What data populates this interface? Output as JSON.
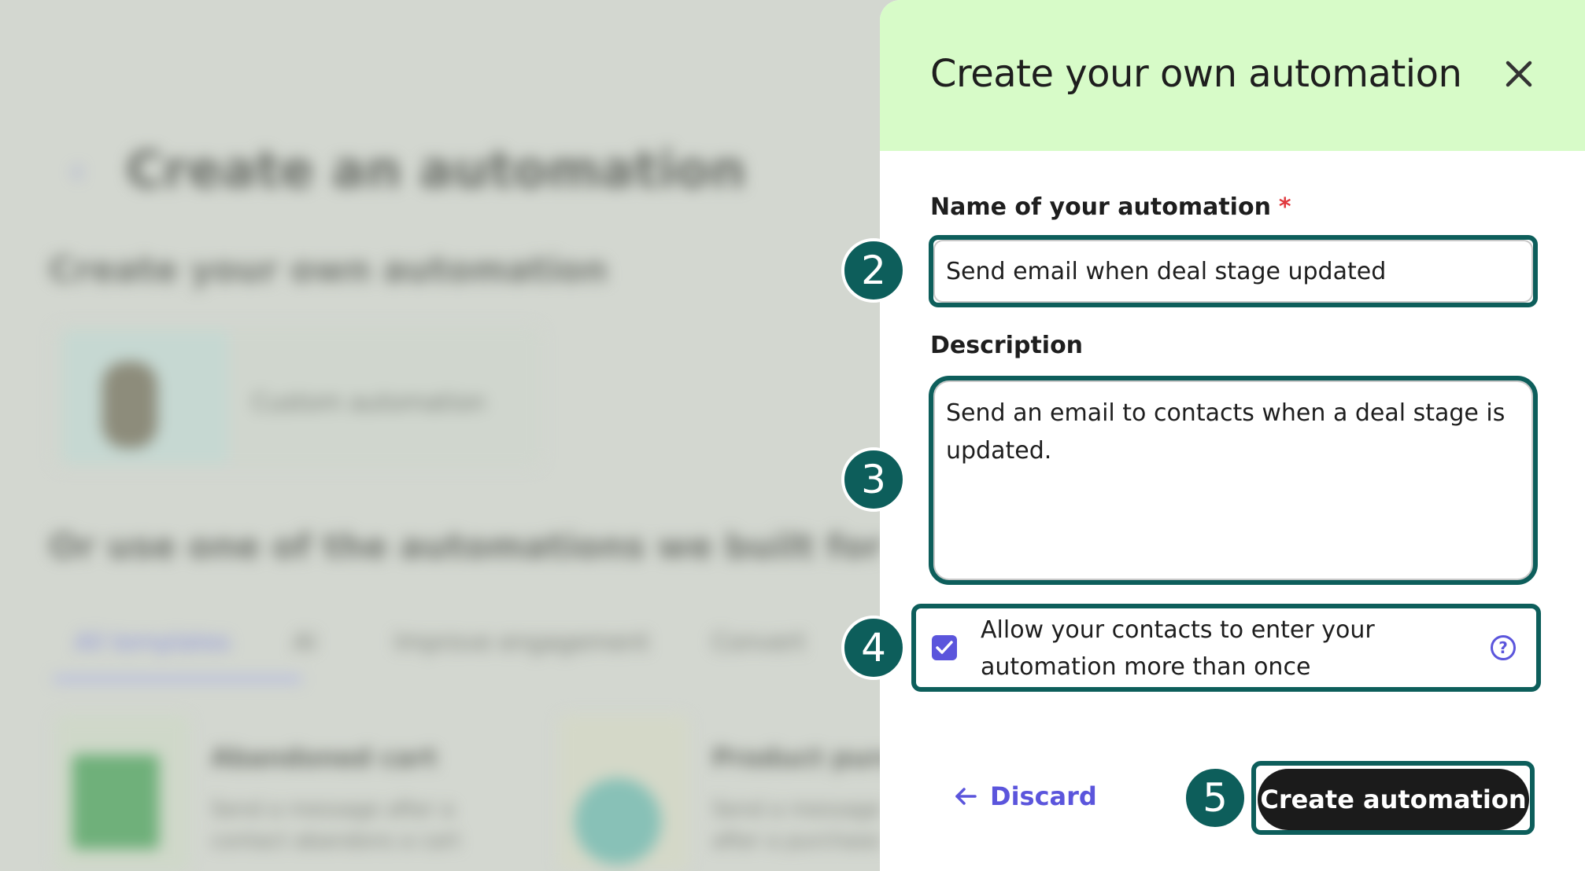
{
  "background": {
    "title": "Create an automation",
    "subtitle": "Create your own automation",
    "card_label": "Custom automation",
    "section_heading": "Or use one of the automations we built for you",
    "tabs": [
      "All templates",
      "AI",
      "Improve engagement",
      "Convert"
    ],
    "template_cards": [
      {
        "title": "Abandoned cart",
        "lines": [
          "Send a message after a",
          "contact abandons a cart"
        ]
      },
      {
        "title": "Product purchase",
        "lines": [
          "Send a message",
          "after a purchase"
        ]
      }
    ]
  },
  "panel": {
    "title": "Create your own automation",
    "close_icon": "close-icon",
    "name_field": {
      "label": "Name of your automation",
      "required_mark": "*",
      "value": "Send email when deal stage updated"
    },
    "description_field": {
      "label": "Description",
      "value": "Send an email to contacts when a deal stage is updated."
    },
    "reentry_checkbox": {
      "checked": true,
      "label": "Allow your contacts to enter your automation more than once",
      "help_icon": "question-circle-icon"
    },
    "discard_label": "Discard",
    "create_label": "Create automation"
  },
  "steps": [
    "2",
    "3",
    "4",
    "5"
  ],
  "colors": {
    "header_bg": "#d7fbc8",
    "accent": "#5b55dc",
    "highlight": "#0d5e5b",
    "primary_button": "#1b1b1b",
    "required": "#e0393e"
  }
}
